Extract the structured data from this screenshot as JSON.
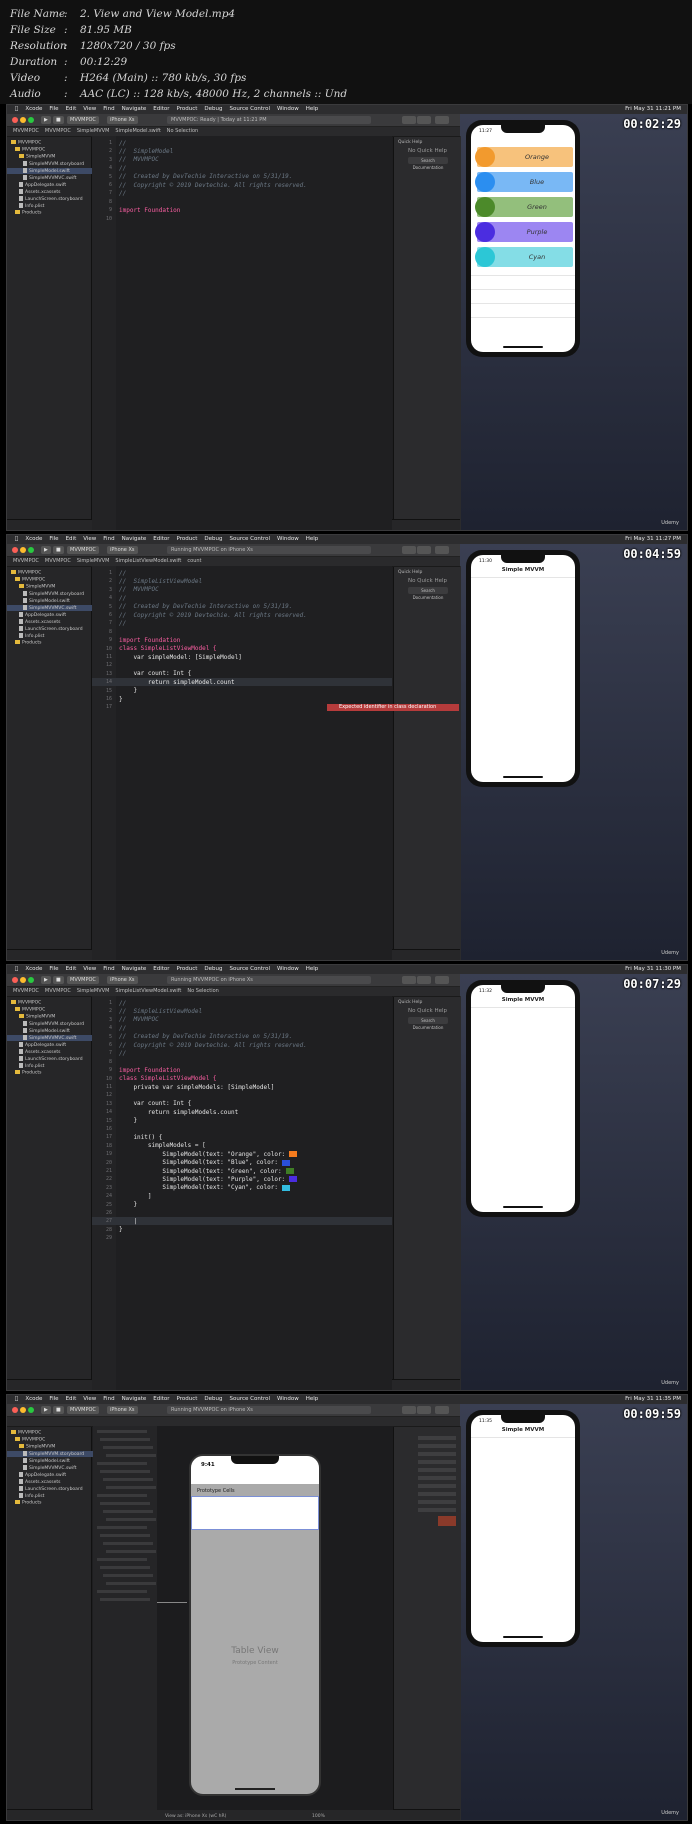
{
  "header": {
    "rows": [
      {
        "key": "File Name",
        "value": "2. View and View Model.mp4"
      },
      {
        "key": "File Size",
        "value": "81.95 MB"
      },
      {
        "key": "Resolution",
        "value": "1280x720 / 30 fps"
      },
      {
        "key": "Duration",
        "value": "00:12:29"
      },
      {
        "key": "Video",
        "value": "H264 (Main) :: 780 kb/s, 30 fps"
      },
      {
        "key": "Audio",
        "value": "AAC (LC) :: 128 kb/s, 48000 Hz, 2 channels :: Und"
      }
    ]
  },
  "menu": {
    "apple": "",
    "items": [
      "Xcode",
      "File",
      "Edit",
      "View",
      "Find",
      "Navigate",
      "Editor",
      "Product",
      "Debug",
      "Source Control",
      "Window",
      "Help"
    ]
  },
  "frames": [
    {
      "timestamp": "00:02:29",
      "clock": "Fri May 31 11:21 PM",
      "scheme": "MVVMPOC",
      "device": "iPhone Xs",
      "status": "MVVMPOC: Ready | Today at 11:21 PM",
      "jump": [
        "MVVMPOC",
        "MVVMPOC",
        "SimpleMVVM",
        "SimpleModel.swift",
        "No Selection"
      ],
      "files": [
        "MVVMPOC",
        "MVVMPOC",
        "SimpleMVVM",
        "SimpleMVVM.storyboard",
        "SimpleModel.swift",
        "SimpleMVVMVC.swift",
        "AppDelegate.swift",
        "Assets.xcassets",
        "LaunchScreen.storyboard",
        "Info.plist",
        "Products"
      ],
      "code": [
        {
          "n": "1",
          "t": "//"
        },
        {
          "n": "2",
          "t": "//  SimpleModel"
        },
        {
          "n": "3",
          "t": "//  MVVMPOC"
        },
        {
          "n": "4",
          "t": "//"
        },
        {
          "n": "5",
          "t": "//  Created by DevTechie Interactive on 5/31/19."
        },
        {
          "n": "6",
          "t": "//  Copyright © 2019 Devtechie. All rights reserved."
        },
        {
          "n": "7",
          "t": "//"
        },
        {
          "n": "8",
          "t": ""
        },
        {
          "n": "9",
          "t": "import Foundation"
        },
        {
          "n": "10",
          "t": ""
        }
      ],
      "phone": {
        "time": "11:27",
        "title": "",
        "rows": [
          {
            "label": "Orange",
            "color": "#f29a2e",
            "light": "#f7c27c"
          },
          {
            "label": "Blue",
            "color": "#2b8ef0",
            "light": "#79b8f5"
          },
          {
            "label": "Green",
            "color": "#4c8a2a",
            "light": "#93bf7c"
          },
          {
            "label": "Purple",
            "color": "#4b2de0",
            "light": "#9c86f2"
          },
          {
            "label": "Cyan",
            "color": "#2cc7d6",
            "light": "#84dde6"
          }
        ]
      }
    },
    {
      "timestamp": "00:04:59",
      "clock": "Fri May 31 11:27 PM",
      "scheme": "MVVMPOC",
      "device": "iPhone Xs",
      "status": "Running MVVMPOC on iPhone Xs",
      "jump": [
        "MVVMPOC",
        "MVVMPOC",
        "SimpleMVVM",
        "SimpleListViewModel.swift",
        "count"
      ],
      "code": [
        {
          "n": "1",
          "t": "//"
        },
        {
          "n": "2",
          "t": "//  SimpleListViewModel"
        },
        {
          "n": "3",
          "t": "//  MVVMPOC"
        },
        {
          "n": "4",
          "t": "//"
        },
        {
          "n": "5",
          "t": "//  Created by DevTechie Interactive on 5/31/19."
        },
        {
          "n": "6",
          "t": "//  Copyright © 2019 Devtechie. All rights reserved."
        },
        {
          "n": "7",
          "t": "//"
        },
        {
          "n": "8",
          "t": ""
        },
        {
          "n": "9",
          "t": "import Foundation"
        },
        {
          "n": "10",
          "t": "class SimpleListViewModel {"
        },
        {
          "n": "11",
          "t": "    var simpleModel: [SimpleModel]"
        },
        {
          "n": "12",
          "t": ""
        },
        {
          "n": "13",
          "t": "    var count: Int {"
        },
        {
          "n": "14",
          "t": "        return simpleModel.count"
        },
        {
          "n": "15",
          "t": "    }"
        },
        {
          "n": "16",
          "t": "}"
        },
        {
          "n": "17",
          "t": ""
        }
      ],
      "error": "Expected identifier in class declaration",
      "phone": {
        "time": "11:30",
        "title": "Simple MVVM"
      }
    },
    {
      "timestamp": "00:07:29",
      "clock": "Fri May 31 11:30 PM",
      "scheme": "MVVMPOC",
      "device": "iPhone Xs",
      "status": "Running MVVMPOC on iPhone Xs",
      "jump": [
        "MVVMPOC",
        "MVVMPOC",
        "SimpleMVVM",
        "SimpleListViewModel.swift",
        "No Selection"
      ],
      "code": [
        {
          "n": "1",
          "t": "//"
        },
        {
          "n": "2",
          "t": "//  SimpleListViewModel"
        },
        {
          "n": "3",
          "t": "//  MVVMPOC"
        },
        {
          "n": "4",
          "t": "//"
        },
        {
          "n": "5",
          "t": "//  Created by DevTechie Interactive on 5/31/19."
        },
        {
          "n": "6",
          "t": "//  Copyright © 2019 Devtechie. All rights reserved."
        },
        {
          "n": "7",
          "t": "//"
        },
        {
          "n": "8",
          "t": ""
        },
        {
          "n": "9",
          "t": "import Foundation"
        },
        {
          "n": "10",
          "t": "class SimpleListViewModel {"
        },
        {
          "n": "11",
          "t": "    private var simpleModels: [SimpleModel]"
        },
        {
          "n": "12",
          "t": ""
        },
        {
          "n": "13",
          "t": "    var count: Int {"
        },
        {
          "n": "14",
          "t": "        return simpleModels.count"
        },
        {
          "n": "15",
          "t": "    }"
        },
        {
          "n": "16",
          "t": ""
        },
        {
          "n": "17",
          "t": "    init() {"
        },
        {
          "n": "18",
          "t": "        simpleModels = ["
        },
        {
          "n": "19",
          "t": "            SimpleModel(text: \"Orange\", color: "
        },
        {
          "n": "20",
          "t": "            SimpleModel(text: \"Blue\", color: "
        },
        {
          "n": "21",
          "t": "            SimpleModel(text: \"Green\", color: "
        },
        {
          "n": "22",
          "t": "            SimpleModel(text: \"Purple\", color: "
        },
        {
          "n": "23",
          "t": "            SimpleModel(text: \"Cyan\", color: "
        },
        {
          "n": "24",
          "t": "        ]"
        },
        {
          "n": "25",
          "t": "    }"
        },
        {
          "n": "26",
          "t": ""
        },
        {
          "n": "27",
          "t": "    |"
        },
        {
          "n": "28",
          "t": "}"
        },
        {
          "n": "29",
          "t": ""
        }
      ],
      "phone": {
        "time": "11:32",
        "title": "Simple MVVM"
      }
    },
    {
      "timestamp": "00:09:59",
      "clock": "Fri May 31 11:35 PM",
      "scheme": "MVVMPOC",
      "device": "iPhone Xs",
      "status": "Running MVVMPOC on iPhone Xs",
      "storyboard": {
        "time": "9:41",
        "section": "Prototype Cells",
        "placeholder_title": "Table View",
        "placeholder_sub": "Prototype Content",
        "view_as": "View as: iPhone Xs (wC hR)",
        "zoom": "100%"
      },
      "phone": {
        "time": "11:35",
        "title": "Simple MVVM"
      }
    }
  ],
  "udemy": "Udemy"
}
